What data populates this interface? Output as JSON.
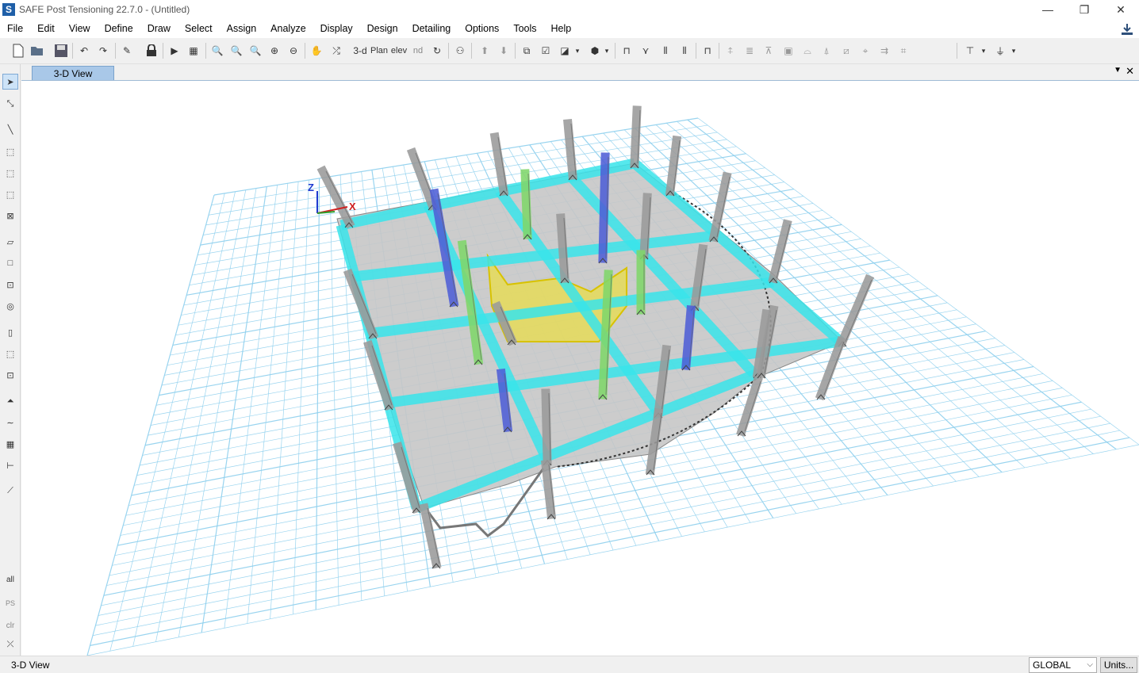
{
  "titlebar": {
    "app_icon_letter": "S",
    "title": "SAFE Post Tensioning 22.7.0 - (Untitled)",
    "minimize": "—",
    "maximize": "❐",
    "close": "✕"
  },
  "menu": [
    "File",
    "Edit",
    "View",
    "Define",
    "Draw",
    "Select",
    "Assign",
    "Analyze",
    "Display",
    "Design",
    "Detailing",
    "Options",
    "Tools",
    "Help"
  ],
  "toolbar": {
    "view_3d_label": "3-d",
    "plan_label": "Plan",
    "elev_label": "elev",
    "nd_label": "nd"
  },
  "left_toolbar": {
    "all_label": "all",
    "ps_label": "PS",
    "clr_label": "clr"
  },
  "tabs": {
    "active": "3-D View"
  },
  "viewport": {
    "axis_z": "Z",
    "axis_x": "X",
    "colors": {
      "beam": "#38e4ea",
      "slab": "#c6c6c6",
      "column": "#9a9a9a",
      "wall": "#eadd4a",
      "grid": "#8fd0ee",
      "column_blue": "#4f5fd6",
      "column_green": "#7fd66a"
    }
  },
  "statusbar": {
    "view_name": "3-D View",
    "coord_system": "GLOBAL",
    "units_button": "Units..."
  }
}
